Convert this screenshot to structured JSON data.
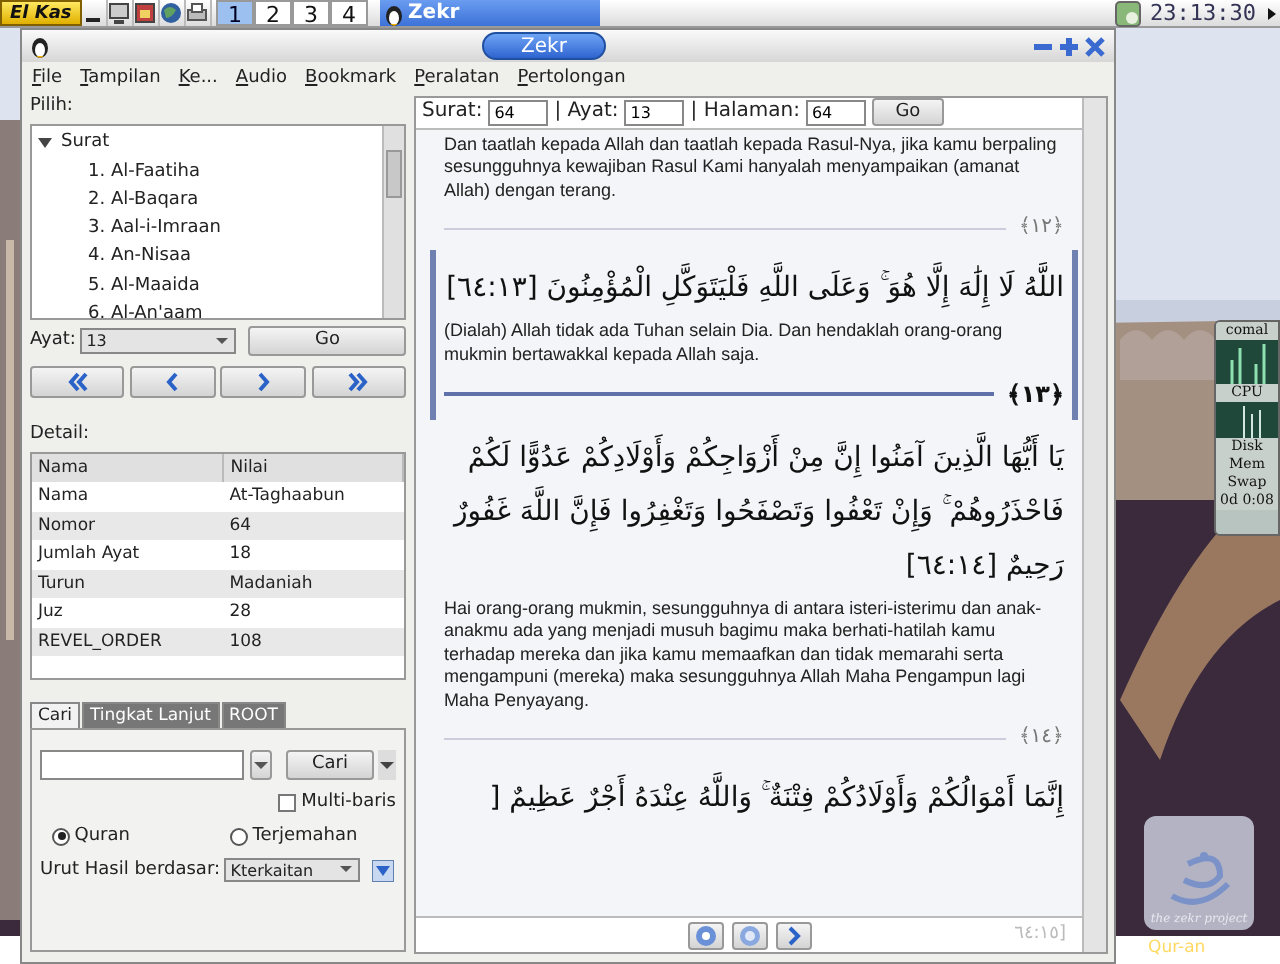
{
  "taskbar": {
    "start_button": "El Kas",
    "workspaces": [
      {
        "label": "1",
        "selected": true
      },
      {
        "label": "2",
        "selected": false
      },
      {
        "label": "3",
        "selected": false
      },
      {
        "label": "4",
        "selected": false
      }
    ],
    "task": {
      "title": "Zekr",
      "selected": true
    },
    "clock": "23:13:30"
  },
  "window": {
    "title": "Zekr"
  },
  "menu": [
    "File",
    "Tampilan",
    "Ke...",
    "Audio",
    "Bookmark",
    "Peralatan",
    "Pertolongan"
  ],
  "sidebar": {
    "pick_label": "Pilih:",
    "tree": {
      "label": "Surat",
      "expanded": true,
      "children": [
        {
          "label": "1. Al-Faatiha"
        },
        {
          "label": "2. Al-Baqara"
        },
        {
          "label": "3. Aal-i-Imraan"
        },
        {
          "label": "4. An-Nisaa"
        },
        {
          "label": "5. Al-Maaida"
        },
        {
          "label": "6. Al-An'aam"
        }
      ]
    },
    "ayat": {
      "label": "Ayat:",
      "value": "13"
    },
    "go": "Go",
    "nav_buttons": [
      {
        "kind": "first"
      },
      {
        "kind": "prev"
      },
      {
        "kind": "next"
      },
      {
        "kind": "last"
      }
    ],
    "detail": {
      "label": "Detail:",
      "columns": [
        "Nama",
        "Nilai"
      ],
      "rows": [
        [
          "Nama",
          "At-Taghaabun"
        ],
        [
          "Nomor",
          "64"
        ],
        [
          "Jumlah Ayat",
          "18"
        ],
        [
          "Turun",
          "Madaniah"
        ],
        [
          "Juz",
          "28"
        ],
        [
          "REVEL_ORDER",
          "108"
        ]
      ]
    },
    "tabs": [
      {
        "label": "Cari",
        "selected": true
      },
      {
        "label": "Tingkat Lanjut",
        "selected": false
      },
      {
        "label": "ROOT",
        "selected": false
      }
    ],
    "search": {
      "button": "Cari",
      "multiline": {
        "label": "Multi-baris",
        "checked": false
      },
      "scope": [
        {
          "label": "Quran",
          "selected": true
        },
        {
          "label": "Terjemahan",
          "selected": false
        }
      ],
      "sort": {
        "label": "Urut Hasil berdasar:",
        "value": "Kterkaitan"
      }
    }
  },
  "content": {
    "toolbar": {
      "surat_label": "Surat:",
      "surat": "64",
      "ayat_label": "| Ayat:",
      "ayat": "13",
      "page_label": "| Halaman:",
      "page": "64",
      "go": "Go"
    },
    "verses": [
      {
        "translation": "Dan taatlah kepada Allah dan taatlah kepada Rasul-Nya, jika kamu berpaling sesungguhnya kewajiban Rasul Kami hanyalah menyampaikan (amanat Allah) dengan terang.",
        "number": "﴿١٢﴾",
        "selected": false
      },
      {
        "arabic": "اللَّهُ لَا إِلَٰهَ إِلَّا هُوَ ۚ وَعَلَى اللَّهِ فَلْيَتَوَكَّلِ الْمُؤْمِنُونَ [٦٤:١٣]",
        "translation": "(Dialah) Allah tidak ada Tuhan selain Dia. Dan hendaklah orang-orang mukmin bertawakkal kepada Allah saja.",
        "number": "﴿١٣﴾",
        "selected": true
      },
      {
        "arabic": "يَا أَيُّهَا الَّذِينَ آمَنُوا إِنَّ مِنْ أَزْوَاجِكُمْ وَأَوْلَادِكُمْ عَدُوًّا لَكُمْ فَاحْذَرُوهُمْ ۚ وَإِنْ تَعْفُوا وَتَصْفَحُوا وَتَغْفِرُوا فَإِنَّ اللَّهَ غَفُورٌ رَحِيمٌ [٦٤:١٤]",
        "translation": "Hai orang-orang mukmin, sesungguhnya di antara isteri-isterimu dan anak-anakmu ada yang menjadi musuh bagimu maka berhati-hatilah kamu terhadap mereka dan jika kamu memaafkan dan tidak memarahi serta mengampuni (mereka) maka sesungguhnya Allah Maha Pengampun lagi Maha Penyayang.",
        "number": "﴿١٤﴾",
        "selected": false
      },
      {
        "arabic": "إِنَّمَا أَمْوَالُكُمْ وَأَوْلَادُكُمْ فِتْنَةٌ ۚ وَاللَّهُ عِنْدَهُ أَجْرٌ عَظِيمٌ [",
        "selected": false
      }
    ],
    "hidden_reference": "٦٤:١٥]"
  },
  "desktop": {
    "monitor": {
      "host": "comal",
      "labels": [
        "CPU",
        "Disk",
        "Mem",
        "Swap"
      ],
      "uptime": "0d 0:08"
    },
    "logo_caption": "the zekr project",
    "icon_label": "Qur-an"
  }
}
